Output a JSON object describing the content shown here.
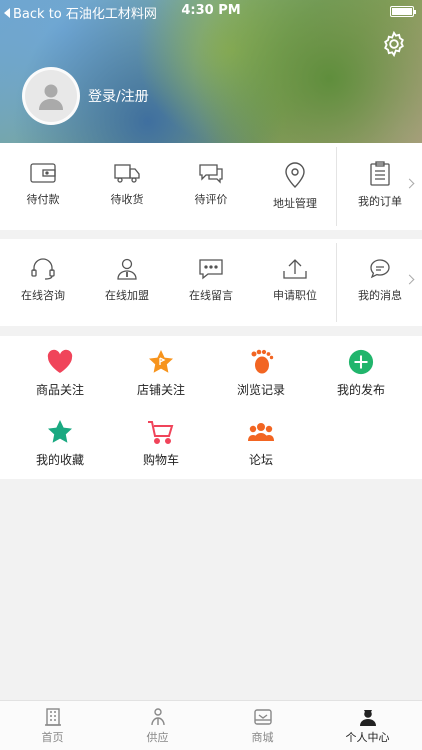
{
  "status_bar": {
    "back_label": "Back to 石油化工材料网",
    "time": "4:30 PM"
  },
  "header": {
    "login_label": "登录/注册"
  },
  "orders": {
    "items": [
      {
        "label": "待付款",
        "icon": "wallet-icon"
      },
      {
        "label": "待收货",
        "icon": "truck-icon"
      },
      {
        "label": "待评价",
        "icon": "comment-icon"
      },
      {
        "label": "地址管理",
        "icon": "location-pin-icon"
      }
    ],
    "more_label": "我的订单"
  },
  "services": {
    "items": [
      {
        "label": "在线咨询",
        "icon": "headset-icon"
      },
      {
        "label": "在线加盟",
        "icon": "user-join-icon"
      },
      {
        "label": "在线留言",
        "icon": "message-icon"
      },
      {
        "label": "申请职位",
        "icon": "upload-icon"
      }
    ],
    "more_label": "我的消息"
  },
  "favorites": {
    "items": [
      {
        "label": "商品关注",
        "icon": "heart-icon",
        "color": "#f0445a"
      },
      {
        "label": "店铺关注",
        "icon": "star-flag-icon",
        "color": "#f7941d"
      },
      {
        "label": "浏览记录",
        "icon": "footprint-icon",
        "color": "#f26522"
      },
      {
        "label": "我的发布",
        "icon": "plus-circle-icon",
        "color": "#21b56c"
      },
      {
        "label": "我的收藏",
        "icon": "star-icon",
        "color": "#1aa981"
      },
      {
        "label": "购物车",
        "icon": "cart-icon",
        "color": "#f0445a"
      },
      {
        "label": "论坛",
        "icon": "group-icon",
        "color": "#f26522"
      }
    ]
  },
  "tabbar": {
    "items": [
      {
        "label": "首页",
        "icon": "building-icon",
        "active": false
      },
      {
        "label": "供应",
        "icon": "supply-icon",
        "active": false
      },
      {
        "label": "商城",
        "icon": "mall-icon",
        "active": false
      },
      {
        "label": "个人中心",
        "icon": "person-icon",
        "active": true
      }
    ]
  }
}
